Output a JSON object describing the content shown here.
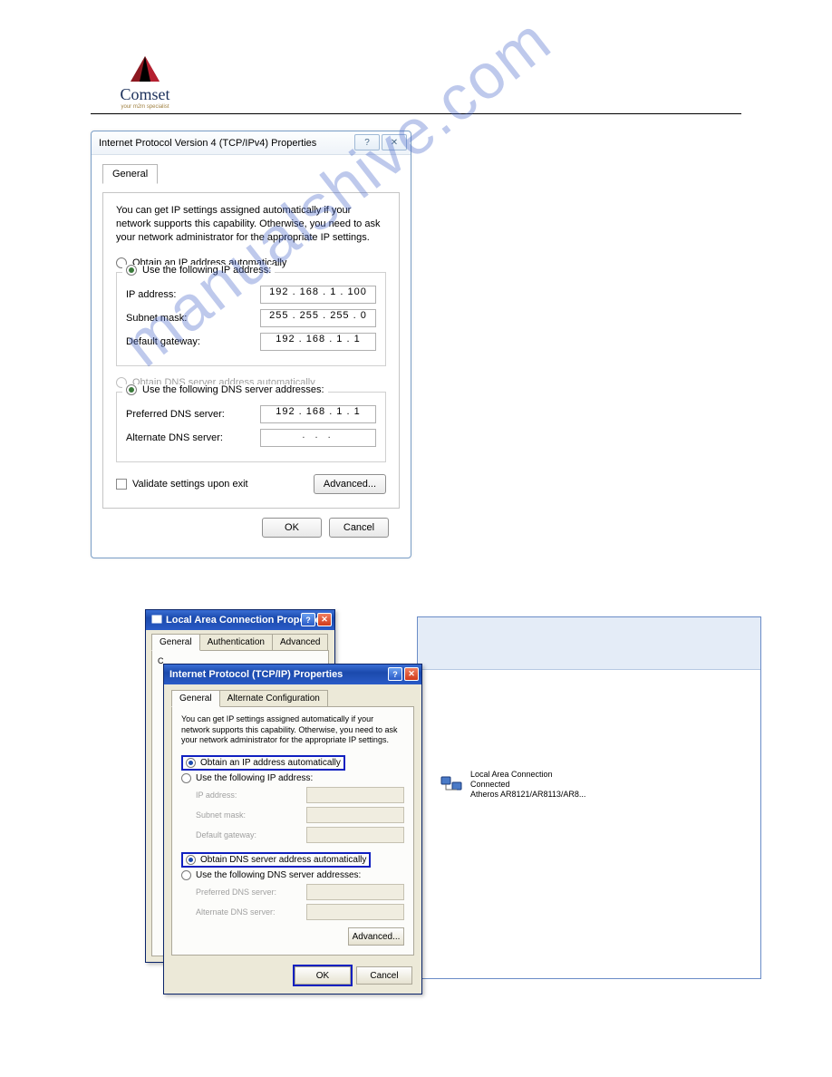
{
  "logo": {
    "name": "Comset",
    "tagline": "your m2m specialist"
  },
  "watermark": "manualshive.com",
  "dialog1": {
    "title": "Internet Protocol Version 4 (TCP/IPv4) Properties",
    "tab": "General",
    "info": "You can get IP settings assigned automatically if your network supports this capability. Otherwise, you need to ask your network administrator for the appropriate IP settings.",
    "radio_auto_ip": "Obtain an IP address automatically",
    "radio_manual_ip": "Use the following IP address:",
    "ip_address_label": "IP address:",
    "ip_address_value": "192 . 168 .   1  . 100",
    "subnet_label": "Subnet mask:",
    "subnet_value": "255 . 255 . 255 .  0",
    "gateway_label": "Default gateway:",
    "gateway_value": "192 . 168 .   1  .   1",
    "radio_auto_dns": "Obtain DNS server address automatically",
    "radio_manual_dns": "Use the following DNS server addresses:",
    "pref_dns_label": "Preferred DNS server:",
    "pref_dns_value": "192 . 168 .   1  .   1",
    "alt_dns_label": "Alternate DNS server:",
    "alt_dns_value": ".       .       .",
    "validate": "Validate settings upon exit",
    "advanced": "Advanced...",
    "ok": "OK",
    "cancel": "Cancel"
  },
  "lac": {
    "title": "Local Area Connection Properties",
    "tabs": [
      "General",
      "Authentication",
      "Advanced"
    ],
    "connect_label": "C"
  },
  "tcpip": {
    "title": "Internet Protocol (TCP/IP) Properties",
    "tabs": [
      "General",
      "Alternate Configuration"
    ],
    "info": "You can get IP settings assigned automatically if your network supports this capability. Otherwise, you need to ask your network administrator for the appropriate IP settings.",
    "radio_auto_ip": "Obtain an IP address automatically",
    "radio_manual_ip": "Use the following IP address:",
    "ip_address_label": "IP address:",
    "subnet_label": "Subnet mask:",
    "gateway_label": "Default gateway:",
    "radio_auto_dns": "Obtain DNS server address automatically",
    "radio_manual_dns": "Use the following DNS server addresses:",
    "pref_dns_label": "Preferred DNS server:",
    "alt_dns_label": "Alternate DNS server:",
    "advanced": "Advanced...",
    "ok": "OK",
    "cancel": "Cancel"
  },
  "network_item": {
    "name": "Local Area Connection",
    "status": "Connected",
    "adapter": "Atheros AR8121/AR8113/AR8..."
  }
}
